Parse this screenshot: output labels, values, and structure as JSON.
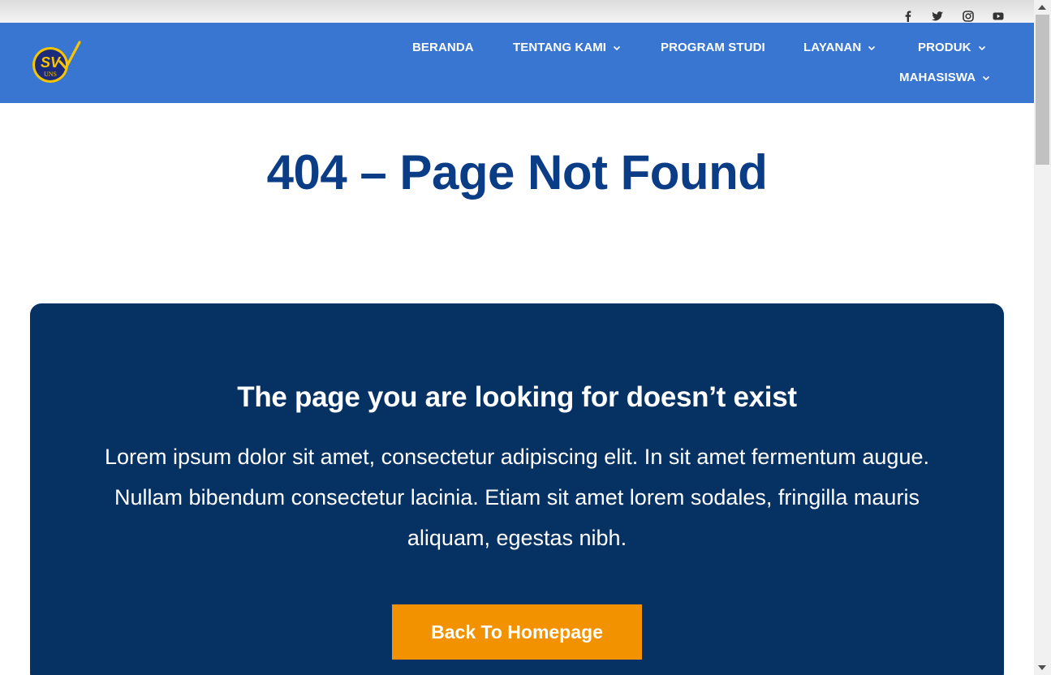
{
  "social": {
    "icons": [
      "facebook-icon",
      "twitter-icon",
      "instagram-icon",
      "youtube-icon"
    ]
  },
  "logo": {
    "text_main": "SV",
    "text_sub": "UNS"
  },
  "nav": {
    "beranda": "BERANDA",
    "tentang_kami": "TENTANG KAMI",
    "program_studi": "PROGRAM STUDI",
    "layanan": "LAYANAN",
    "produk": "PRODUK",
    "mahasiswa": "MAHASISWA"
  },
  "page": {
    "title": "404 – Page Not Found"
  },
  "panel": {
    "heading": "The page you are looking for doesn’t exist",
    "body": "Lorem ipsum dolor sit amet, consectetur adipiscing elit. In sit amet fermentum augue. Nullam bibendum consectetur lacinia. Etiam sit amet lorem sodales, fringilla mauris aliquam, egestas nibh.",
    "button_label": "Back To Homepage"
  },
  "colors": {
    "header_bg": "#3876d2",
    "title": "#0b3d86",
    "panel_bg": "#063163",
    "button_bg": "#f39200"
  }
}
